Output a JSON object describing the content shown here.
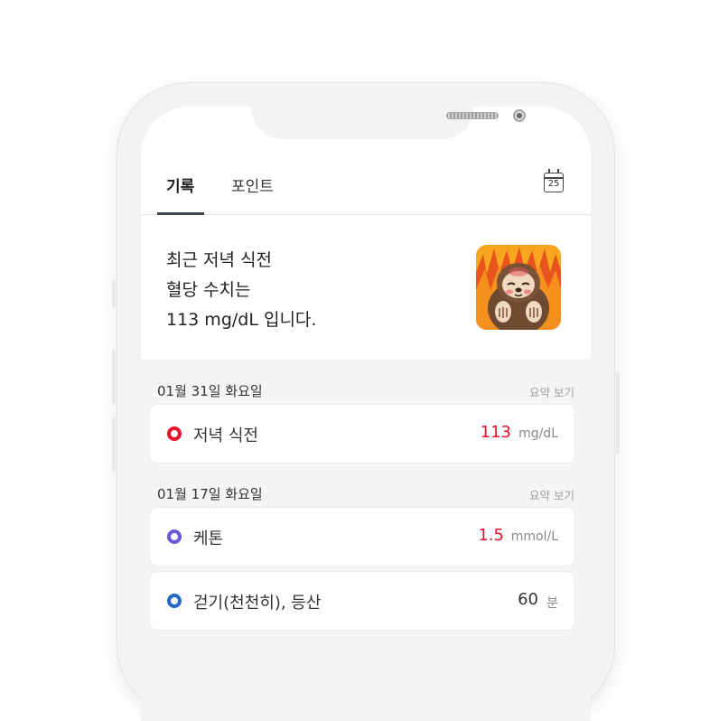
{
  "tabs": [
    {
      "label": "기록",
      "active": true
    },
    {
      "label": "포인트",
      "active": false
    }
  ],
  "calendar": {
    "day": "25"
  },
  "hero": {
    "line1": "최근 저녁 식전",
    "line2": "혈당 수치는",
    "line3": "113 mg/dL 입니다."
  },
  "groups": [
    {
      "date": "01월 31일 화요일",
      "summary": "요약 보기",
      "items": [
        {
          "label": "저녁 식전",
          "value": "113",
          "unit": "mg/dL",
          "dot_color": "#e8102b",
          "value_color": "#e8102b"
        }
      ]
    },
    {
      "date": "01월 17일 화요일",
      "summary": "요약 보기",
      "items": [
        {
          "label": "케톤",
          "value": "1.5",
          "unit": "mmol/L",
          "dot_color": "#6e55d8",
          "value_color": "#e8102b"
        },
        {
          "label": "걷기(천천히), 등산",
          "value": "60",
          "unit": "분",
          "dot_color": "#2369c2",
          "value_color": "#333333"
        }
      ]
    }
  ]
}
